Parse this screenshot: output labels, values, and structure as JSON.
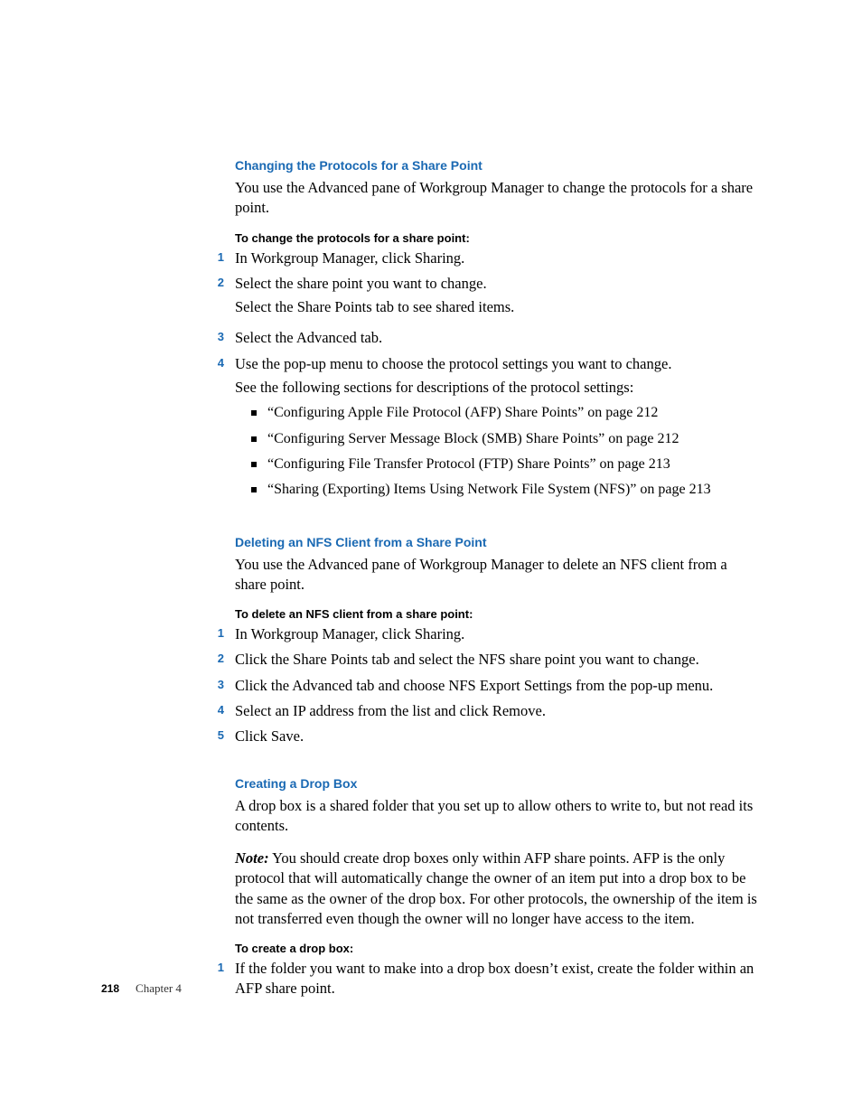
{
  "sections": {
    "s1": {
      "heading": "Changing the Protocols for a Share Point",
      "intro": "You use the Advanced pane of Workgroup Manager to change the protocols for a share point.",
      "procedure_heading": "To change the protocols for a share point:",
      "steps": {
        "n1": "1",
        "t1": "In Workgroup Manager, click Sharing.",
        "n2": "2",
        "t2": "Select the share point you want to change.",
        "t2b": "Select the Share Points tab to see shared items.",
        "n3": "3",
        "t3": "Select the Advanced tab.",
        "n4": "4",
        "t4": "Use the pop-up menu to choose the protocol settings you want to change.",
        "t4b": "See the following sections for descriptions of the protocol settings:",
        "b1": "“Configuring Apple File Protocol (AFP) Share Points” on page 212",
        "b2": "“Configuring Server Message Block (SMB) Share Points” on page 212",
        "b3": "“Configuring File Transfer Protocol (FTP) Share Points” on page 213",
        "b4": "“Sharing (Exporting) Items Using Network File System (NFS)” on page 213"
      }
    },
    "s2": {
      "heading": "Deleting an NFS Client from a Share Point",
      "intro": "You use the Advanced pane of Workgroup Manager to delete an NFS client from a share point.",
      "procedure_heading": "To delete an NFS client from a share point:",
      "steps": {
        "n1": "1",
        "t1": "In Workgroup Manager, click Sharing.",
        "n2": "2",
        "t2": "Click the Share Points tab and select the NFS share point you want to change.",
        "n3": "3",
        "t3": "Click the Advanced tab and choose NFS Export Settings from the pop-up menu.",
        "n4": "4",
        "t4": "Select an IP address from the list and click Remove.",
        "n5": "5",
        "t5": "Click Save."
      }
    },
    "s3": {
      "heading": "Creating a Drop Box",
      "intro": "A drop box is a shared folder that you set up to allow others to write to, but not read its contents.",
      "note_label": "Note:",
      "note_body": "  You should create drop boxes only within AFP share points. AFP is the only protocol that will automatically change the owner of an item put into a drop box to be the same as the owner of the drop box. For other protocols, the ownership of the item is not transferred even though the owner will no longer have access to the item.",
      "procedure_heading": "To create a drop box:",
      "steps": {
        "n1": "1",
        "t1": "If the folder you want to make into a drop box doesn’t exist, create the folder within an AFP share point."
      }
    }
  },
  "footer": {
    "page_number": "218",
    "chapter": "Chapter  4"
  }
}
